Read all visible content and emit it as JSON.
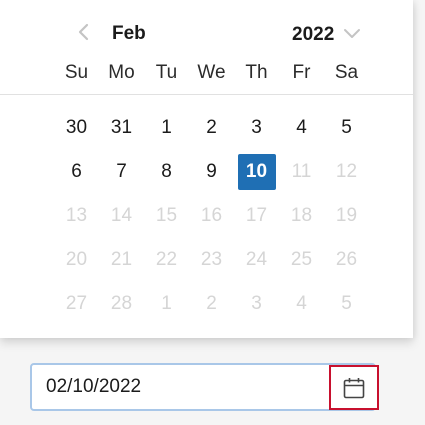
{
  "calendar": {
    "month": "Feb",
    "year": "2022",
    "weekdays": [
      "Su",
      "Mo",
      "Tu",
      "We",
      "Th",
      "Fr",
      "Sa"
    ],
    "weeks": [
      [
        {
          "label": "30",
          "muted": false,
          "selected": false
        },
        {
          "label": "31",
          "muted": false,
          "selected": false
        },
        {
          "label": "1",
          "muted": false,
          "selected": false
        },
        {
          "label": "2",
          "muted": false,
          "selected": false
        },
        {
          "label": "3",
          "muted": false,
          "selected": false
        },
        {
          "label": "4",
          "muted": false,
          "selected": false
        },
        {
          "label": "5",
          "muted": false,
          "selected": false
        }
      ],
      [
        {
          "label": "6",
          "muted": false,
          "selected": false
        },
        {
          "label": "7",
          "muted": false,
          "selected": false
        },
        {
          "label": "8",
          "muted": false,
          "selected": false
        },
        {
          "label": "9",
          "muted": false,
          "selected": false
        },
        {
          "label": "10",
          "muted": false,
          "selected": true
        },
        {
          "label": "11",
          "muted": true,
          "selected": false
        },
        {
          "label": "12",
          "muted": true,
          "selected": false
        }
      ],
      [
        {
          "label": "13",
          "muted": true,
          "selected": false
        },
        {
          "label": "14",
          "muted": true,
          "selected": false
        },
        {
          "label": "15",
          "muted": true,
          "selected": false
        },
        {
          "label": "16",
          "muted": true,
          "selected": false
        },
        {
          "label": "17",
          "muted": true,
          "selected": false
        },
        {
          "label": "18",
          "muted": true,
          "selected": false
        },
        {
          "label": "19",
          "muted": true,
          "selected": false
        }
      ],
      [
        {
          "label": "20",
          "muted": true,
          "selected": false
        },
        {
          "label": "21",
          "muted": true,
          "selected": false
        },
        {
          "label": "22",
          "muted": true,
          "selected": false
        },
        {
          "label": "23",
          "muted": true,
          "selected": false
        },
        {
          "label": "24",
          "muted": true,
          "selected": false
        },
        {
          "label": "25",
          "muted": true,
          "selected": false
        },
        {
          "label": "26",
          "muted": true,
          "selected": false
        }
      ],
      [
        {
          "label": "27",
          "muted": true,
          "selected": false
        },
        {
          "label": "28",
          "muted": true,
          "selected": false
        },
        {
          "label": "1",
          "muted": true,
          "selected": false
        },
        {
          "label": "2",
          "muted": true,
          "selected": false
        },
        {
          "label": "3",
          "muted": true,
          "selected": false
        },
        {
          "label": "4",
          "muted": true,
          "selected": false
        },
        {
          "label": "5",
          "muted": true,
          "selected": false
        }
      ]
    ],
    "icons": {
      "prev": "chevron-left-icon",
      "year_dropdown": "chevron-down-icon"
    }
  },
  "date_input": {
    "value": "02/10/2022",
    "button_icon": "calendar-icon"
  },
  "colors": {
    "selected_bg": "#1f6fb4",
    "muted_text": "#d5d5d5",
    "input_border": "#a9c7e8",
    "highlight_border": "#c8102e"
  }
}
